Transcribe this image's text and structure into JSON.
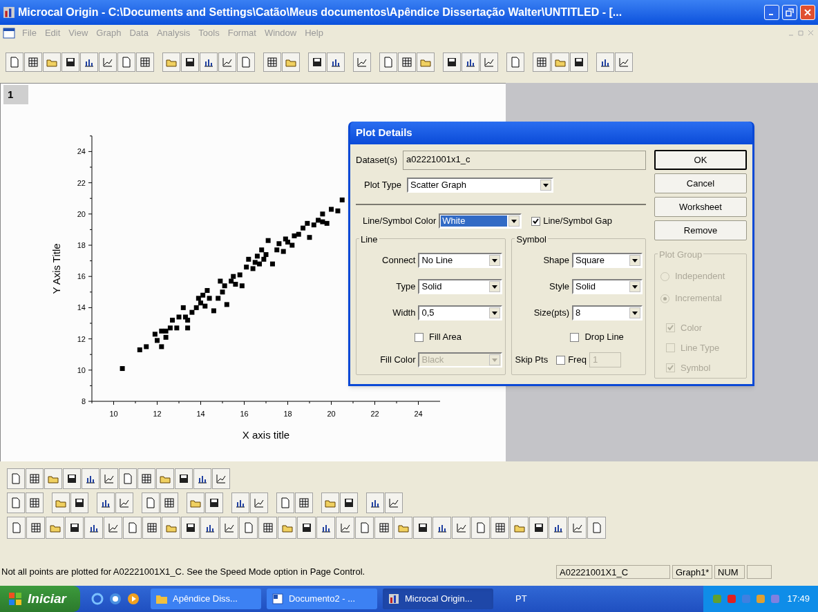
{
  "window": {
    "title": "Microcal Origin - C:\\Documents and Settings\\Catão\\Meus documentos\\Apêndice Dissertação Walter\\UNTITLED - [..."
  },
  "menu": [
    "File",
    "Edit",
    "View",
    "Graph",
    "Data",
    "Analysis",
    "Tools",
    "Format",
    "Window",
    "Help"
  ],
  "graph_window": {
    "page_label": "1",
    "chart_data": {
      "type": "scatter",
      "xlabel": "X axis title",
      "ylabel": "Y Axis Title",
      "xlim": [
        9,
        25
      ],
      "ylim": [
        8,
        25
      ],
      "xticks": [
        10,
        12,
        14,
        16,
        18,
        20,
        22,
        24
      ],
      "yticks": [
        8,
        10,
        12,
        14,
        16,
        18,
        20,
        22,
        24
      ],
      "x": [
        10.4,
        11.2,
        11.5,
        11.9,
        12.0,
        12.2,
        12.2,
        12.4,
        12.4,
        12.6,
        12.7,
        12.9,
        13.0,
        13.2,
        13.3,
        13.4,
        13.4,
        13.6,
        13.8,
        13.9,
        14.0,
        14.1,
        14.2,
        14.3,
        14.4,
        14.6,
        14.8,
        14.9,
        15.0,
        15.1,
        15.2,
        15.4,
        15.5,
        15.6,
        15.8,
        15.9,
        16.1,
        16.2,
        16.4,
        16.5,
        16.6,
        16.7,
        16.8,
        16.9,
        17.0,
        17.1,
        17.3,
        17.5,
        17.6,
        17.8,
        17.9,
        18.0,
        18.2,
        18.3,
        18.5,
        18.7,
        18.9,
        19.0,
        19.2,
        19.4,
        19.6,
        19.6,
        19.8,
        20.0,
        20.3,
        20.5
      ],
      "series": [
        {
          "color": "#000000",
          "values": [
            10.1,
            11.3,
            11.5,
            12.3,
            11.9,
            12.5,
            11.5,
            12.1,
            12.5,
            12.7,
            13.2,
            12.7,
            13.4,
            14.0,
            13.4,
            13.2,
            12.7,
            13.7,
            14.0,
            14.6,
            14.3,
            14.8,
            14.1,
            15.1,
            14.6,
            13.8,
            14.6,
            15.7,
            15.0,
            15.4,
            14.2,
            15.7,
            16.0,
            15.5,
            16.1,
            15.4,
            16.6,
            17.1,
            16.5,
            16.9,
            17.3,
            16.8,
            17.7,
            17.1,
            17.4,
            18.3,
            16.8,
            17.7,
            18.1,
            17.6,
            18.4,
            18.2,
            18.0,
            18.6,
            18.7,
            19.1,
            19.4,
            18.5,
            19.3,
            19.6,
            19.5,
            20.0,
            19.4,
            20.3,
            20.2,
            20.9
          ]
        }
      ]
    }
  },
  "dialog": {
    "title": "Plot Details",
    "dataset": {
      "label": "Dataset(s)",
      "value": "a02221001x1_c"
    },
    "plot_type": {
      "label": "Plot Type",
      "value": "Scatter Graph"
    },
    "color": {
      "label": "Line/Symbol Color",
      "value": "White",
      "selected": true
    },
    "gap": {
      "label": "Line/Symbol Gap",
      "checked": true
    },
    "buttons": [
      {
        "label": "OK",
        "default": true
      },
      {
        "label": "Cancel",
        "default": false
      },
      {
        "label": "Worksheet",
        "default": false
      },
      {
        "label": "Remove",
        "default": false
      }
    ],
    "line": {
      "title": "Line",
      "fields": [
        {
          "label": "Connect",
          "value": "No Line"
        },
        {
          "label": "Type",
          "value": "Solid"
        },
        {
          "label": "Width",
          "value": "0,5"
        }
      ],
      "fill_area": {
        "label": "Fill Area",
        "checked": false
      },
      "fill_color": {
        "label": "Fill Color",
        "value": "Black",
        "disabled": true
      }
    },
    "symbol": {
      "title": "Symbol",
      "fields": [
        {
          "label": "Shape",
          "value": "Square"
        },
        {
          "label": "Style",
          "value": "Solid"
        },
        {
          "label": "Size(pts)",
          "value": "8"
        }
      ],
      "drop_line": {
        "label": "Drop Line",
        "checked": false
      },
      "skip": {
        "label": "Skip Pts",
        "freq_label": "Freq",
        "checked": false,
        "value": "1",
        "disabled": true
      }
    },
    "plot_group": {
      "title": "Plot Group",
      "disabled": true,
      "radios": [
        {
          "label": "Independent",
          "selected": false
        },
        {
          "label": "Incremental",
          "selected": true
        }
      ],
      "checks": [
        {
          "label": "Color",
          "checked": true
        },
        {
          "label": "Line Type",
          "checked": false
        },
        {
          "label": "Symbol",
          "checked": true
        }
      ]
    }
  },
  "status_bar": {
    "message": "Not all points are plotted for A02221001X1_C. See the Speed Mode option in Page Control.",
    "panes": [
      "A02221001X1_C",
      "Graph1*",
      "NUM"
    ]
  },
  "taskbar": {
    "start": "Iniciar",
    "tasks": [
      {
        "label": "Apêndice Diss...",
        "kind": "folder",
        "selected": false
      },
      {
        "label": "Documento2 - ...",
        "kind": "word",
        "selected": false
      },
      {
        "label": "Microcal Origin...",
        "kind": "origin",
        "selected": true
      }
    ],
    "language": "PT",
    "clock": "17:49"
  }
}
